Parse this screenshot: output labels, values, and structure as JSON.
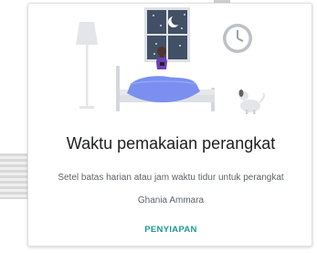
{
  "card": {
    "title": "Waktu pemakaian perangkat",
    "description": "Setel batas harian atau jam waktu tidur untuk perangkat Ghania Ammara",
    "setup_label": "PENYIAPAN"
  },
  "illustration": {
    "icons": [
      "floor-lamp-icon",
      "night-window-icon",
      "wall-clock-icon",
      "bed-icon",
      "person-with-phone-icon",
      "dog-icon"
    ]
  },
  "colors": {
    "accent": "#1a9b93",
    "title_text": "#202124",
    "body_text": "#5f6368",
    "blanket": "#7b8ff0",
    "person_shirt": "#6d3fb7"
  }
}
